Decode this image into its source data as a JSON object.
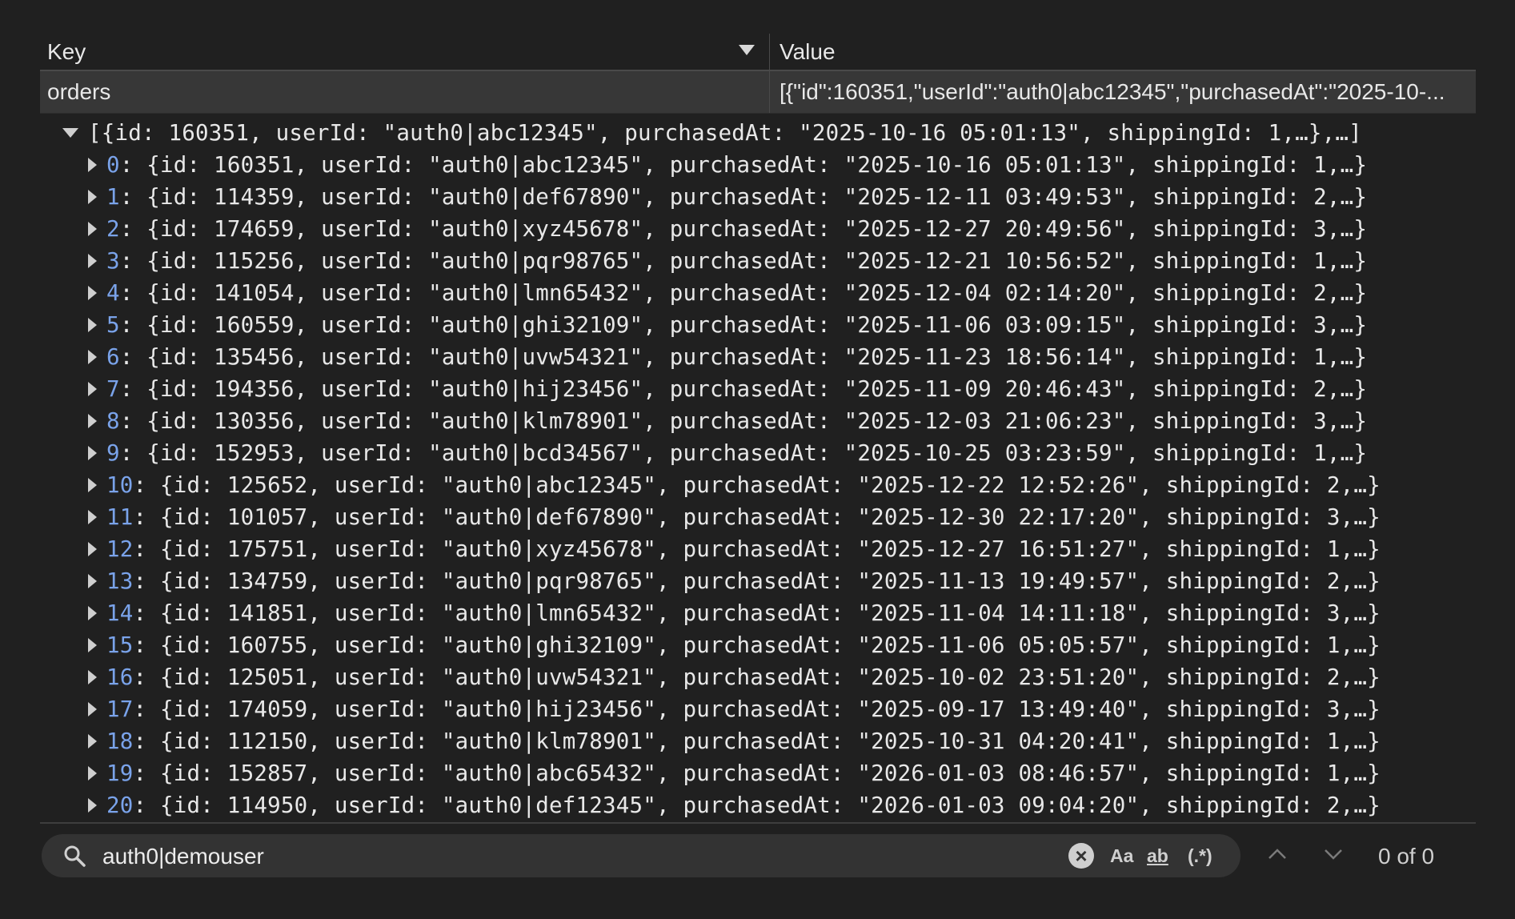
{
  "table": {
    "columns": {
      "key": "Key",
      "value": "Value"
    },
    "rows": [
      {
        "key": "orders",
        "value": "[{\"id\":160351,\"userId\":\"auth0|abc12345\",\"purchasedAt\":\"2025-10-..."
      }
    ]
  },
  "tree": {
    "root": "[{id: 160351, userId: \"auth0|abc12345\", purchasedAt: \"2025-10-16 05:01:13\", shippingId: 1,…},…]",
    "items": [
      {
        "index": "0",
        "text": ": {id: 160351, userId: \"auth0|abc12345\", purchasedAt: \"2025-10-16 05:01:13\", shippingId: 1,…}"
      },
      {
        "index": "1",
        "text": ": {id: 114359, userId: \"auth0|def67890\", purchasedAt: \"2025-12-11 03:49:53\", shippingId: 2,…}"
      },
      {
        "index": "2",
        "text": ": {id: 174659, userId: \"auth0|xyz45678\", purchasedAt: \"2025-12-27 20:49:56\", shippingId: 3,…}"
      },
      {
        "index": "3",
        "text": ": {id: 115256, userId: \"auth0|pqr98765\", purchasedAt: \"2025-12-21 10:56:52\", shippingId: 1,…}"
      },
      {
        "index": "4",
        "text": ": {id: 141054, userId: \"auth0|lmn65432\", purchasedAt: \"2025-12-04 02:14:20\", shippingId: 2,…}"
      },
      {
        "index": "5",
        "text": ": {id: 160559, userId: \"auth0|ghi32109\", purchasedAt: \"2025-11-06 03:09:15\", shippingId: 3,…}"
      },
      {
        "index": "6",
        "text": ": {id: 135456, userId: \"auth0|uvw54321\", purchasedAt: \"2025-11-23 18:56:14\", shippingId: 1,…}"
      },
      {
        "index": "7",
        "text": ": {id: 194356, userId: \"auth0|hij23456\", purchasedAt: \"2025-11-09 20:46:43\", shippingId: 2,…}"
      },
      {
        "index": "8",
        "text": ": {id: 130356, userId: \"auth0|klm78901\", purchasedAt: \"2025-12-03 21:06:23\", shippingId: 3,…}"
      },
      {
        "index": "9",
        "text": ": {id: 152953, userId: \"auth0|bcd34567\", purchasedAt: \"2025-10-25 03:23:59\", shippingId: 1,…}"
      },
      {
        "index": "10",
        "text": ": {id: 125652, userId: \"auth0|abc12345\", purchasedAt: \"2025-12-22 12:52:26\", shippingId: 2,…}"
      },
      {
        "index": "11",
        "text": ": {id: 101057, userId: \"auth0|def67890\", purchasedAt: \"2025-12-30 22:17:20\", shippingId: 3,…}"
      },
      {
        "index": "12",
        "text": ": {id: 175751, userId: \"auth0|xyz45678\", purchasedAt: \"2025-12-27 16:51:27\", shippingId: 1,…}"
      },
      {
        "index": "13",
        "text": ": {id: 134759, userId: \"auth0|pqr98765\", purchasedAt: \"2025-11-13 19:49:57\", shippingId: 2,…}"
      },
      {
        "index": "14",
        "text": ": {id: 141851, userId: \"auth0|lmn65432\", purchasedAt: \"2025-11-04 14:11:18\", shippingId: 3,…}"
      },
      {
        "index": "15",
        "text": ": {id: 160755, userId: \"auth0|ghi32109\", purchasedAt: \"2025-11-06 05:05:57\", shippingId: 1,…}"
      },
      {
        "index": "16",
        "text": ": {id: 125051, userId: \"auth0|uvw54321\", purchasedAt: \"2025-10-02 23:51:20\", shippingId: 2,…}"
      },
      {
        "index": "17",
        "text": ": {id: 174059, userId: \"auth0|hij23456\", purchasedAt: \"2025-09-17 13:49:40\", shippingId: 3,…}"
      },
      {
        "index": "18",
        "text": ": {id: 112150, userId: \"auth0|klm78901\", purchasedAt: \"2025-10-31 04:20:41\", shippingId: 1,…}"
      },
      {
        "index": "19",
        "text": ": {id: 152857, userId: \"auth0|abc65432\", purchasedAt: \"2026-01-03 08:46:57\", shippingId: 1,…}"
      },
      {
        "index": "20",
        "text": ": {id: 114950, userId: \"auth0|def12345\", purchasedAt: \"2026-01-03 09:04:20\", shippingId: 2,…}"
      }
    ]
  },
  "search": {
    "value": "auth0|demouser",
    "match_case_label": "Aa",
    "whole_word_label": "ab",
    "regex_label": "(.*)",
    "match_count": "0 of 0"
  },
  "icons": {
    "search": "search-icon",
    "clear": "clear-icon",
    "prev": "chevron-up-icon",
    "next": "chevron-down-icon",
    "sort": "sort-down-icon"
  },
  "colors": {
    "background": "#202020",
    "row_selected": "#373737",
    "index_blue": "#7aa3ea",
    "search_bg": "#333333"
  }
}
